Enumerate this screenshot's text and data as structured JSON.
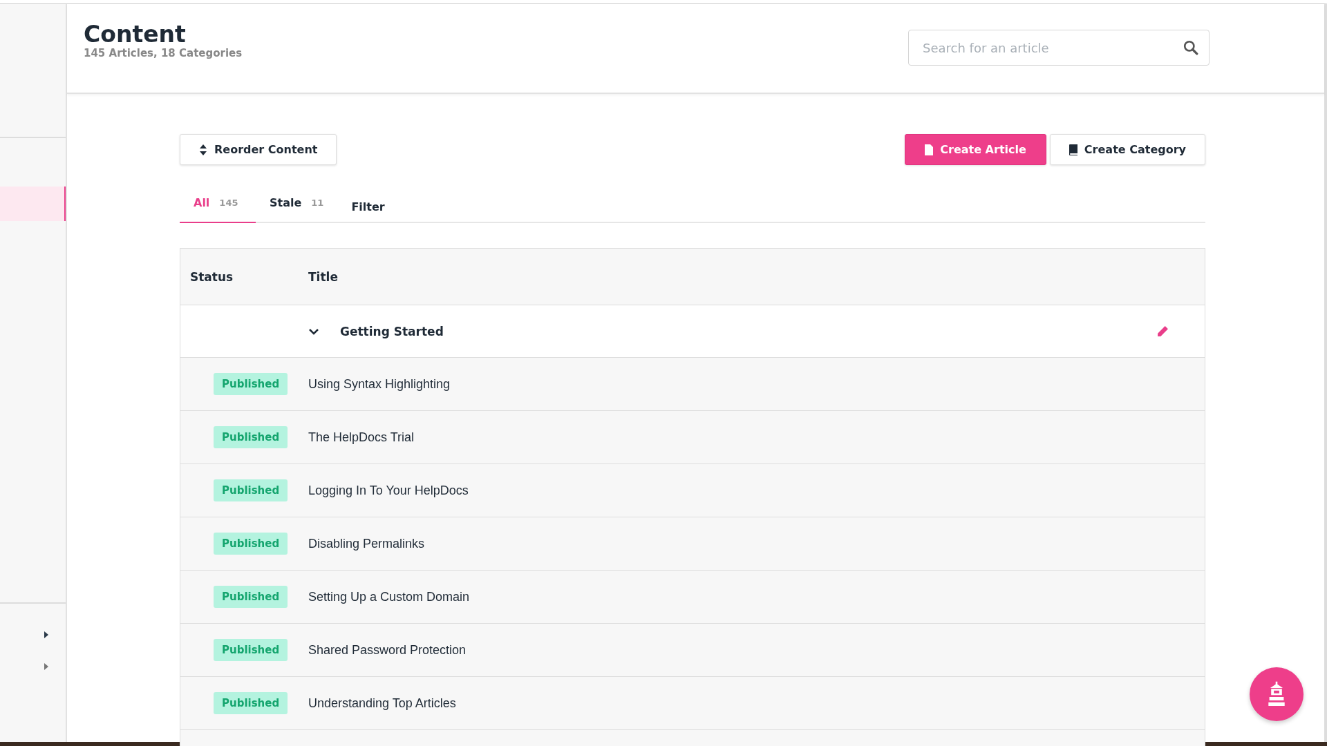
{
  "header": {
    "title": "Content",
    "subtitle": "145 Articles, 18 Categories",
    "search": {
      "placeholder": "Search for an article"
    }
  },
  "toolbar": {
    "reorder_label": "Reorder Content",
    "create_article_label": "Create Article",
    "create_category_label": "Create Category"
  },
  "tabs": [
    {
      "label": "All",
      "count": "145",
      "selected": true
    },
    {
      "label": "Stale",
      "count": "11",
      "selected": false
    }
  ],
  "filter_label": "Filter",
  "table": {
    "columns": [
      "Status",
      "Title"
    ],
    "group": {
      "title": "Getting Started",
      "expanded": true
    },
    "rows": [
      {
        "status": "Published",
        "title": "Using Syntax Highlighting"
      },
      {
        "status": "Published",
        "title": "The HelpDocs Trial"
      },
      {
        "status": "Published",
        "title": "Logging In To Your HelpDocs"
      },
      {
        "status": "Published",
        "title": "Disabling Permalinks"
      },
      {
        "status": "Published",
        "title": "Setting Up a Custom Domain"
      },
      {
        "status": "Published",
        "title": "Shared Password Protection"
      },
      {
        "status": "Published",
        "title": "Understanding Top Articles"
      }
    ]
  }
}
